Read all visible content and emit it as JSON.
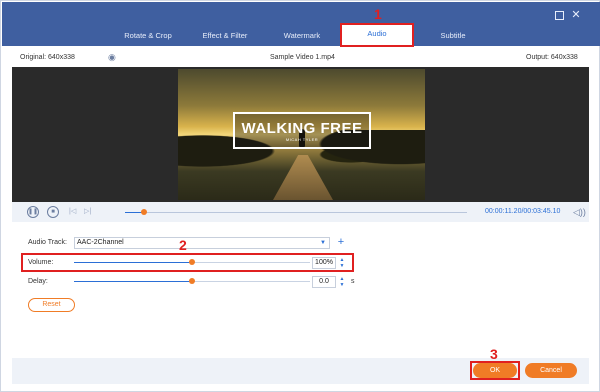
{
  "window": {
    "max_glyph": "",
    "close_glyph": "✕"
  },
  "tabs": [
    {
      "label": "Rotate & Crop"
    },
    {
      "label": "Effect & Filter"
    },
    {
      "label": "Watermark"
    },
    {
      "label": "Audio"
    },
    {
      "label": "Subtitle"
    }
  ],
  "info": {
    "original": "Original: 640x338",
    "filename": "Sample Video 1.mp4",
    "output": "Output: 640x338"
  },
  "video": {
    "title": "WALKING FREE",
    "subtitle": "MICAH TYLER"
  },
  "playback": {
    "time": "00:00:11.20/00:03:45.10",
    "progress": 0.055,
    "icons": [
      "pause-icon",
      "stop-icon",
      "previous-icon",
      "next-icon",
      "volume-icon"
    ]
  },
  "audio": {
    "track_label": "Audio Track:",
    "track_value": "AAC-2Channel",
    "volume_label": "Volume:",
    "volume_value": "100%",
    "volume_level": 0.5,
    "delay_label": "Delay:",
    "delay_value": "0.0",
    "delay_level": 0.5,
    "delay_unit": "s",
    "reset_label": "Reset"
  },
  "footer": {
    "ok_label": "OK",
    "cancel_label": "Cancel"
  },
  "annotations": [
    "1",
    "2",
    "3"
  ],
  "colors": {
    "accent": "#2b6fd6",
    "orange": "#f07c26",
    "header": "#3f5fa0",
    "annotation": "#e02020"
  }
}
